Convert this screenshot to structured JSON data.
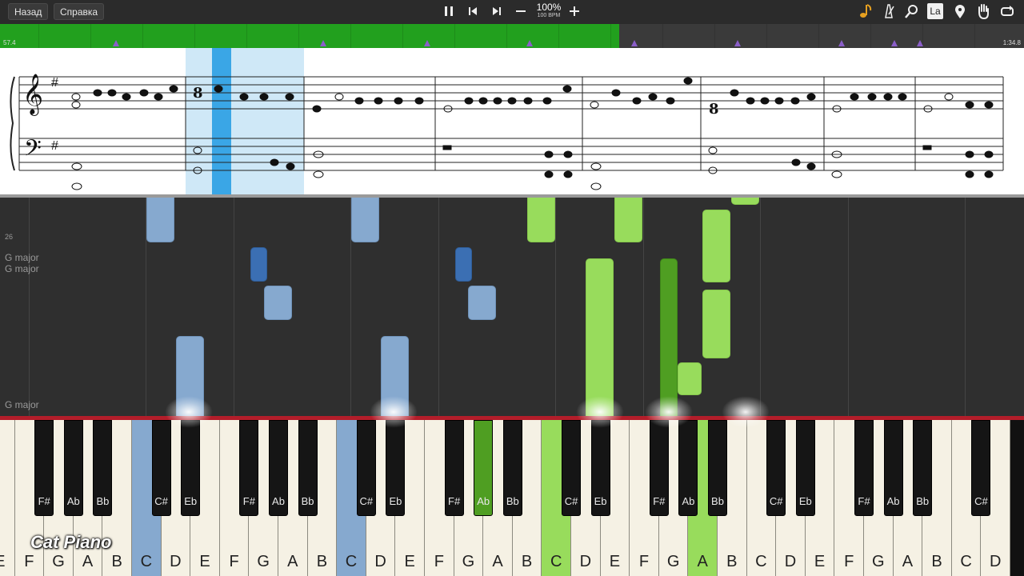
{
  "toolbar": {
    "back_label": "Назад",
    "help_label": "Справка",
    "speed_percent": "100%",
    "speed_bpm": "100 BPM",
    "right_icons": [
      "note-icon",
      "metronome-icon",
      "magnify-icon",
      "label-toggle-icon",
      "location-pin-icon",
      "hand-icon",
      "loop-icon"
    ],
    "label_toggle_text": "La"
  },
  "progress": {
    "current_time": "57.4",
    "total_time": "1:34.8",
    "fraction": 0.605,
    "fill_color": "#22a01e",
    "marker_color": "#8a5ec8"
  },
  "roll": {
    "key_signature_labels": [
      "26",
      "G major",
      "G major",
      "G major"
    ]
  },
  "keyboard": {
    "white_keys": [
      "E",
      "F",
      "G",
      "A",
      "B",
      "C",
      "D",
      "E",
      "F",
      "G",
      "A",
      "B",
      "C",
      "D",
      "E",
      "F",
      "G",
      "A",
      "B",
      "C",
      "D",
      "E",
      "F",
      "G",
      "A",
      "B",
      "C",
      "D",
      "E",
      "F",
      "G",
      "A",
      "B",
      "C",
      "D"
    ],
    "black_keys": [
      "Eb",
      "F#",
      "Ab",
      "Bb",
      "C#",
      "Eb",
      "F#",
      "Ab",
      "Bb",
      "C#",
      "Eb",
      "F#",
      "Ab",
      "Bb",
      "C#",
      "Eb",
      "F#",
      "Ab",
      "Bb",
      "C#",
      "Eb",
      "F#",
      "Ab",
      "Bb",
      "C#",
      ""
    ],
    "pressed_white_blue": [
      5,
      12
    ],
    "pressed_white_green": [
      19,
      24
    ],
    "pressed_black_green": [
      12
    ],
    "colors": {
      "left_hand": "#86a9cf",
      "right_hand": "#98dc5c",
      "pressed_dark_green": "#4f9e22"
    }
  },
  "branding": {
    "logo": "Cat Piano"
  }
}
